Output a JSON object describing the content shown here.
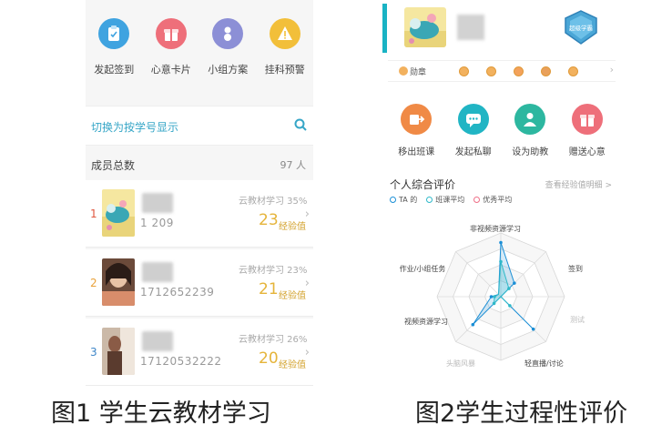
{
  "fig1": {
    "icons": [
      {
        "label": "发起签到",
        "icon": "clipboard-icon",
        "color": "#3fa3e0"
      },
      {
        "label": "心意卡片",
        "icon": "gift-icon",
        "color": "#ee6f7a"
      },
      {
        "label": "小组方案",
        "icon": "group-icon",
        "color": "#8c8fd6"
      },
      {
        "label": "挂科预警",
        "icon": "warning-icon",
        "color": "#f2bf3a"
      }
    ],
    "switch_label": "切换为按学号显示",
    "members_label": "成员总数",
    "members_count": "97 人",
    "students": [
      {
        "rank": "1",
        "rank_color": "#e0573f",
        "phone": "1      209",
        "course": "云教材学习  35%",
        "score": "23",
        "xp": "经验值"
      },
      {
        "rank": "2",
        "rank_color": "#e9a13a",
        "phone": "1712652239",
        "course": "云教材学习  23%",
        "score": "21",
        "xp": "经验值"
      },
      {
        "rank": "3",
        "rank_color": "#3d86c8",
        "phone": "17120532222",
        "course": "云教材学习  26%",
        "score": "20",
        "xp": "经验值"
      }
    ],
    "caption": "图1 学生云教材学习"
  },
  "fig2": {
    "badge_text": "超级学霸",
    "medal_label": "勋章",
    "actions": [
      {
        "label": "移出班课",
        "icon": "remove-icon",
        "color": "#f08a46"
      },
      {
        "label": "发起私聊",
        "icon": "chat-icon",
        "color": "#21b5c4"
      },
      {
        "label": "设为助教",
        "icon": "person-icon",
        "color": "#2db7a0"
      },
      {
        "label": "赠送心意",
        "icon": "gift-icon",
        "color": "#ee6f7a"
      }
    ],
    "eval_title": "个人综合评价",
    "eval_link": "查看经验值明细 >",
    "legend": [
      {
        "label": "TA 的",
        "color": "#1b8fd6"
      },
      {
        "label": "班课平均",
        "color": "#2fb9c9"
      },
      {
        "label": "优秀平均",
        "color": "#ef6f87"
      }
    ],
    "radar_axes": [
      "非视频资源学习",
      "签到",
      "测试",
      "轻直播/讨论",
      "头脑风暴",
      "视频资源学习",
      "作业/小组任务"
    ],
    "caption": "图2学生过程性评价"
  },
  "chart_data": {
    "type": "radar",
    "categories": [
      "非视频资源学习",
      "签到",
      "测试",
      "轻直播/讨论",
      "头脑风暴",
      "视频资源学习",
      "作业/小组任务",
      ""
    ],
    "series": [
      {
        "name": "TA 的",
        "values": [
          0.85,
          0.3,
          0.0,
          0.72,
          0.0,
          0.62,
          0.15,
          0.05
        ]
      },
      {
        "name": "班课平均",
        "values": [
          0.55,
          0.18,
          0.0,
          0.2,
          0.0,
          0.15,
          0.1,
          0.05
        ]
      }
    ],
    "ylim": [
      0,
      1
    ]
  }
}
